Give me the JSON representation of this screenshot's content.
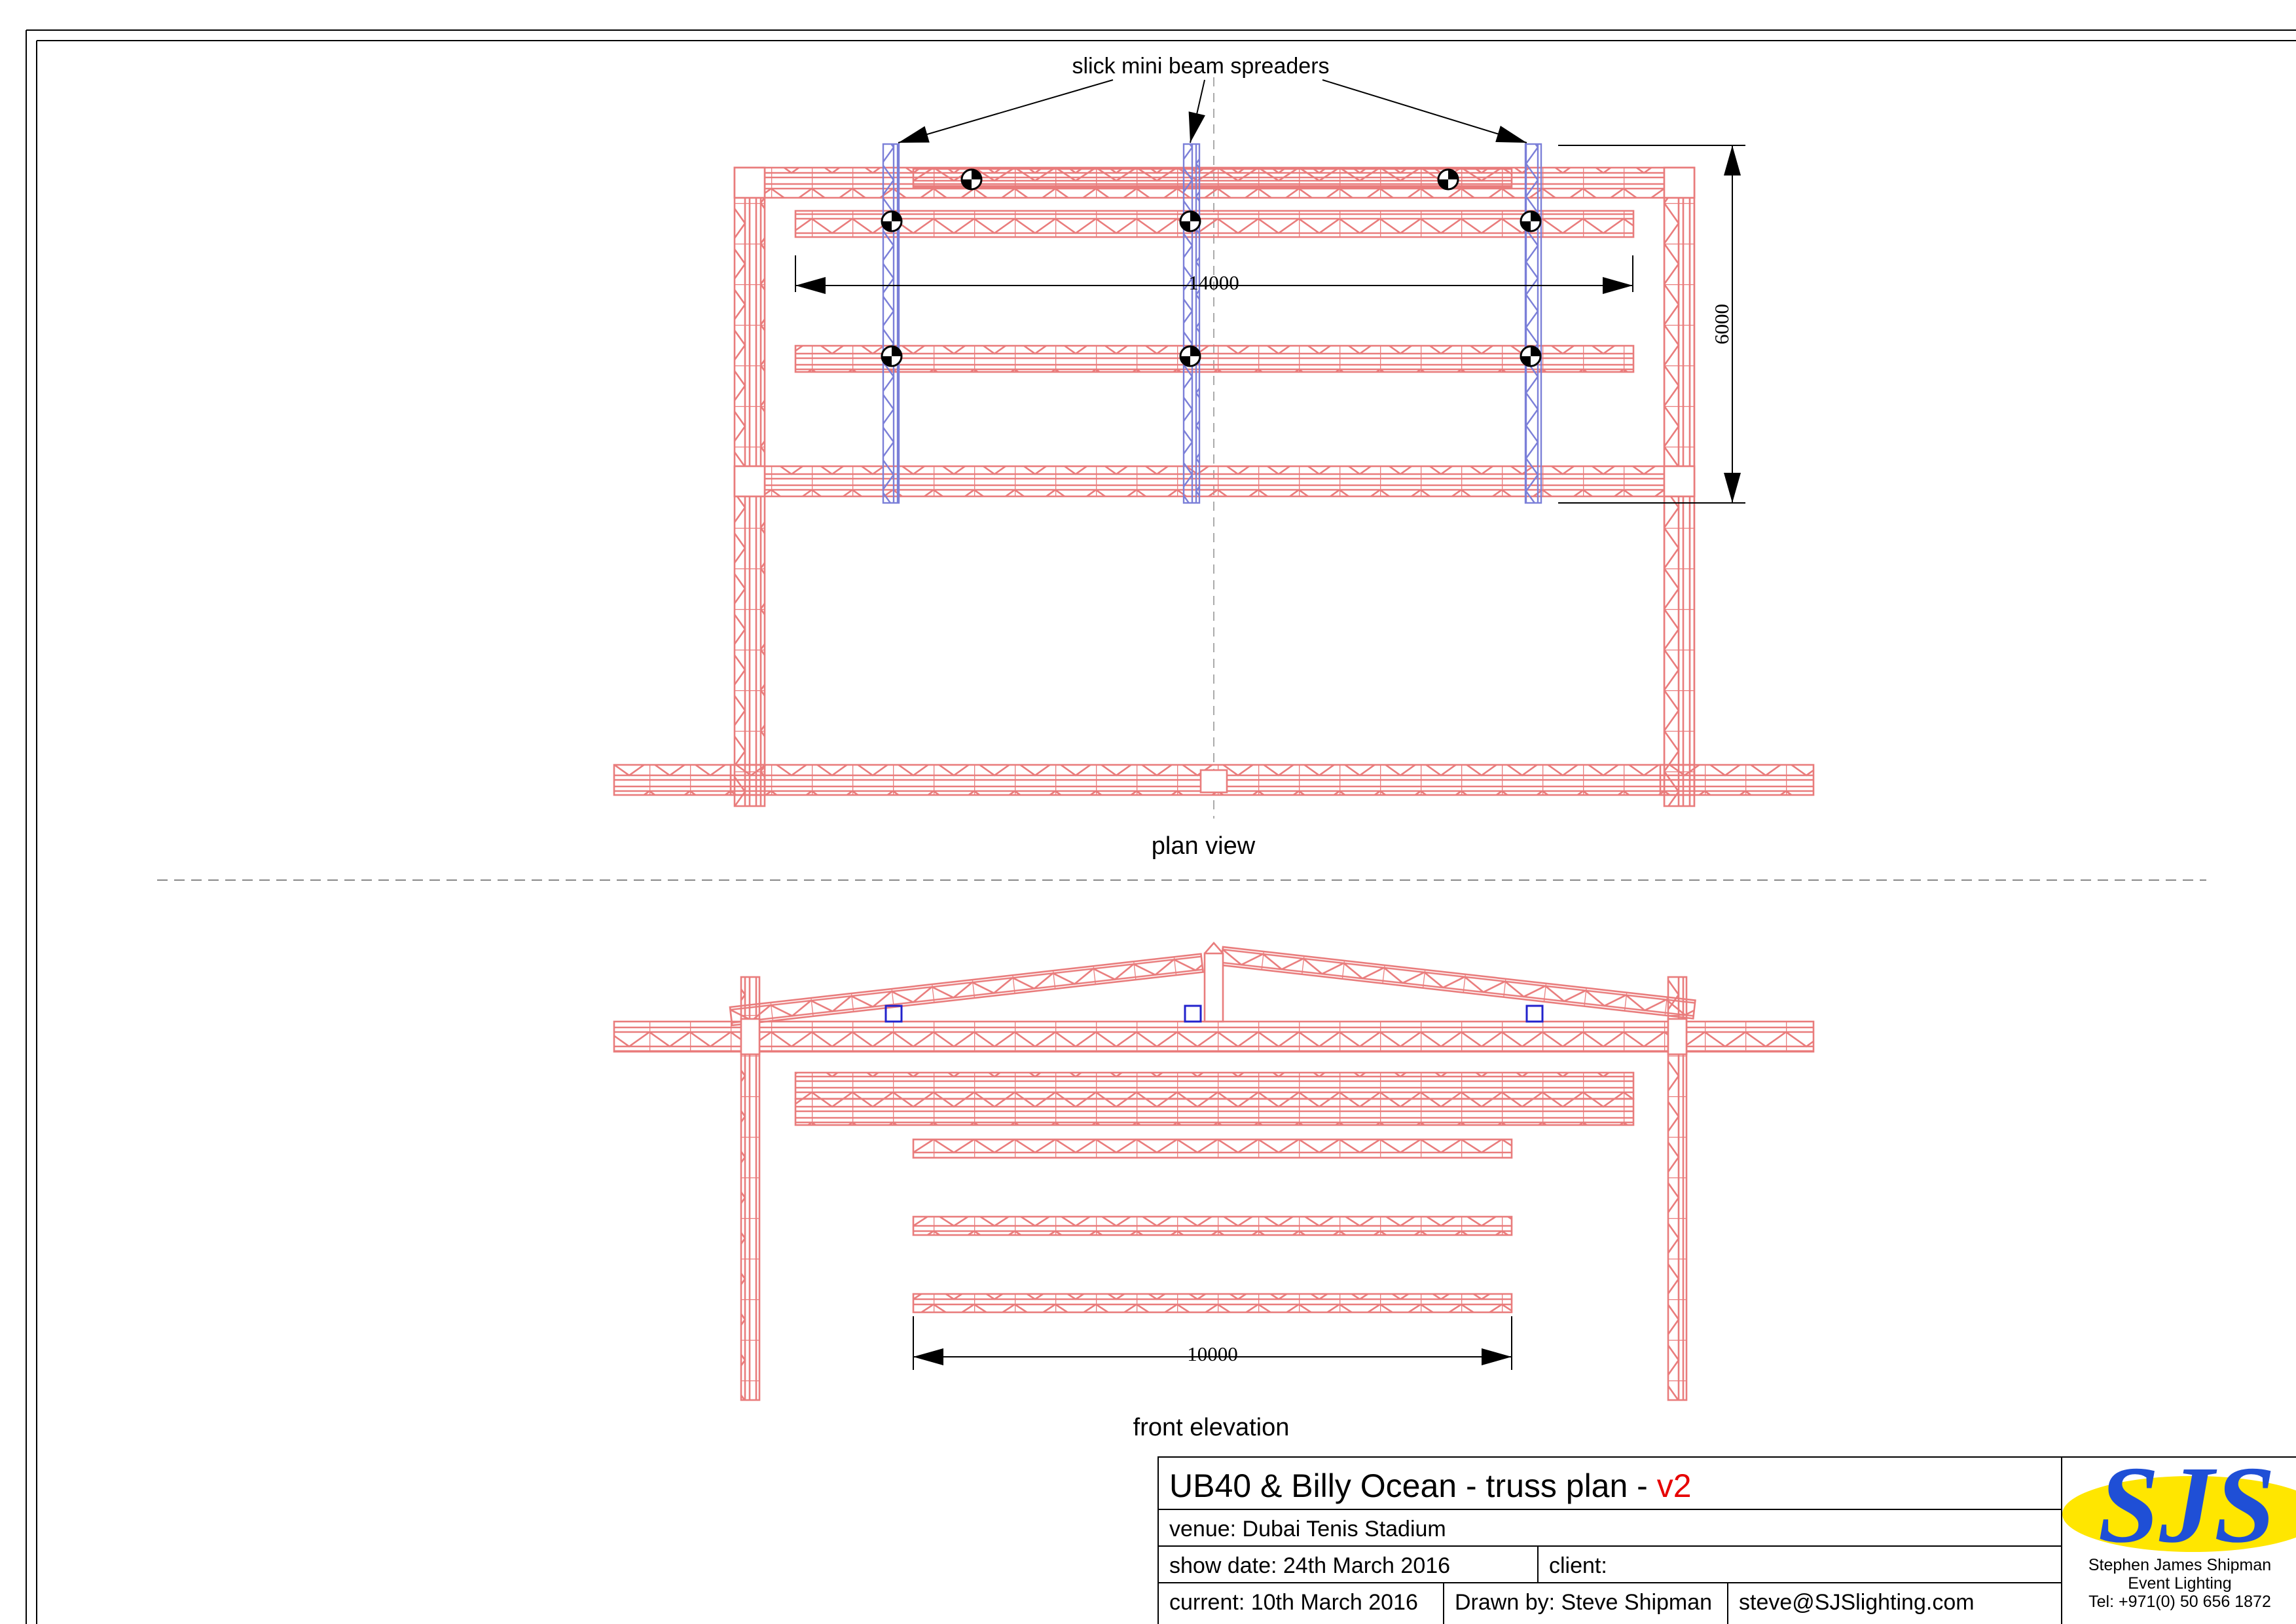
{
  "labels": {
    "spreaders": "slick mini beam spreaders",
    "plan_view": "plan view",
    "front_elevation": "front elevation",
    "dim_14000": "14000",
    "dim_6000": "6000",
    "dim_10000": "10000"
  },
  "title_block": {
    "title": "UB40 & Billy Ocean - truss plan - ",
    "version": "v2",
    "venue": "venue: Dubai  Tenis Stadium",
    "show_date": "show date: 24th March 2016",
    "client": "client:",
    "current": "current: 10th March 2016",
    "drawn_by": "Drawn by: Steve Shipman",
    "email": "steve@SJSlighting.com"
  },
  "logo": {
    "letters": "SJS",
    "line1": "Stephen James Shipman",
    "line2": "Event Lighting",
    "line3": "Tel: +971(0) 50 656 1872"
  },
  "colors": {
    "truss": "#e97c7c",
    "spreader": "#7b7fd8",
    "logo_blue": "#1f4fd6",
    "logo_yellow": "#ffe600",
    "version_red": "#e60000"
  }
}
